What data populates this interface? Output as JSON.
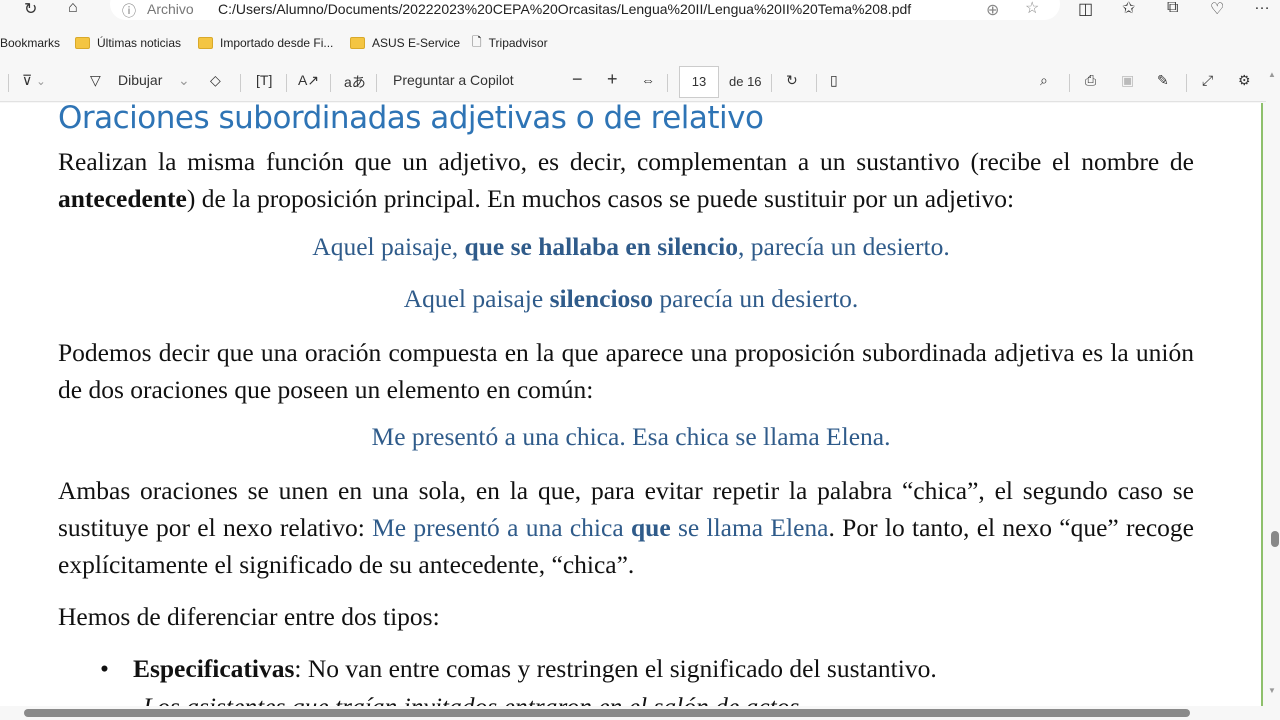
{
  "browser": {
    "url_prefix": "Archivo",
    "url": "C:/Users/Alumno/Documents/20222023%20CEPA%20Orcasitas/Lengua%20II/Lengua%20II%20Tema%208.pdf",
    "bookmarks": [
      "Bookmarks",
      "Últimas noticias",
      "Importado desde Fi...",
      "ASUS E-Service",
      "Tripadvisor"
    ]
  },
  "toolbar": {
    "draw": "Dibujar",
    "copilot": "Preguntar a Copilot",
    "page": "13",
    "of": "de 16"
  },
  "doc": {
    "title": "Oraciones subordinadas adjetivas o de relativo",
    "p1a": "Realizan la misma función que un adjetivo, es decir, complementan a un sustantivo (recibe el nombre de ",
    "p1b": "antecedente",
    "p1c": ") de la proposición principal. En muchos casos se puede sustituir por un adjetivo:",
    "ex1a": "Aquel paisaje, ",
    "ex1b": "que se hallaba en silencio",
    "ex1c": ", parecía un desierto.",
    "ex2a": "Aquel paisaje ",
    "ex2b": "silencioso",
    "ex2c": " parecía un desierto.",
    "p2": "Podemos decir que una oración compuesta en la que aparece una proposición subordinada adjetiva es la unión de dos oraciones que poseen un elemento en común:",
    "ex3": "Me presentó a una chica. Esa chica se llama Elena.",
    "p3a": "Ambas oraciones se unen en una sola, en la que, para evitar repetir la palabra “chica”, el segundo caso se sustituye por el nexo relativo: ",
    "p3b": "Me presentó a una chica ",
    "p3c": "que",
    "p3d": " se llama Elena",
    "p3e": ". Por lo tanto, el nexo “que” recoge explícitamente el significado de su antecedente, “chica”.",
    "p4": "Hemos de diferenciar entre dos tipos:",
    "b1a": "Especificativas",
    "b1b": ": No van entre comas y restringen el significado del sustantivo.",
    "b1ex": "Los asistentes que traían invitados entraron en el salón de actos"
  }
}
